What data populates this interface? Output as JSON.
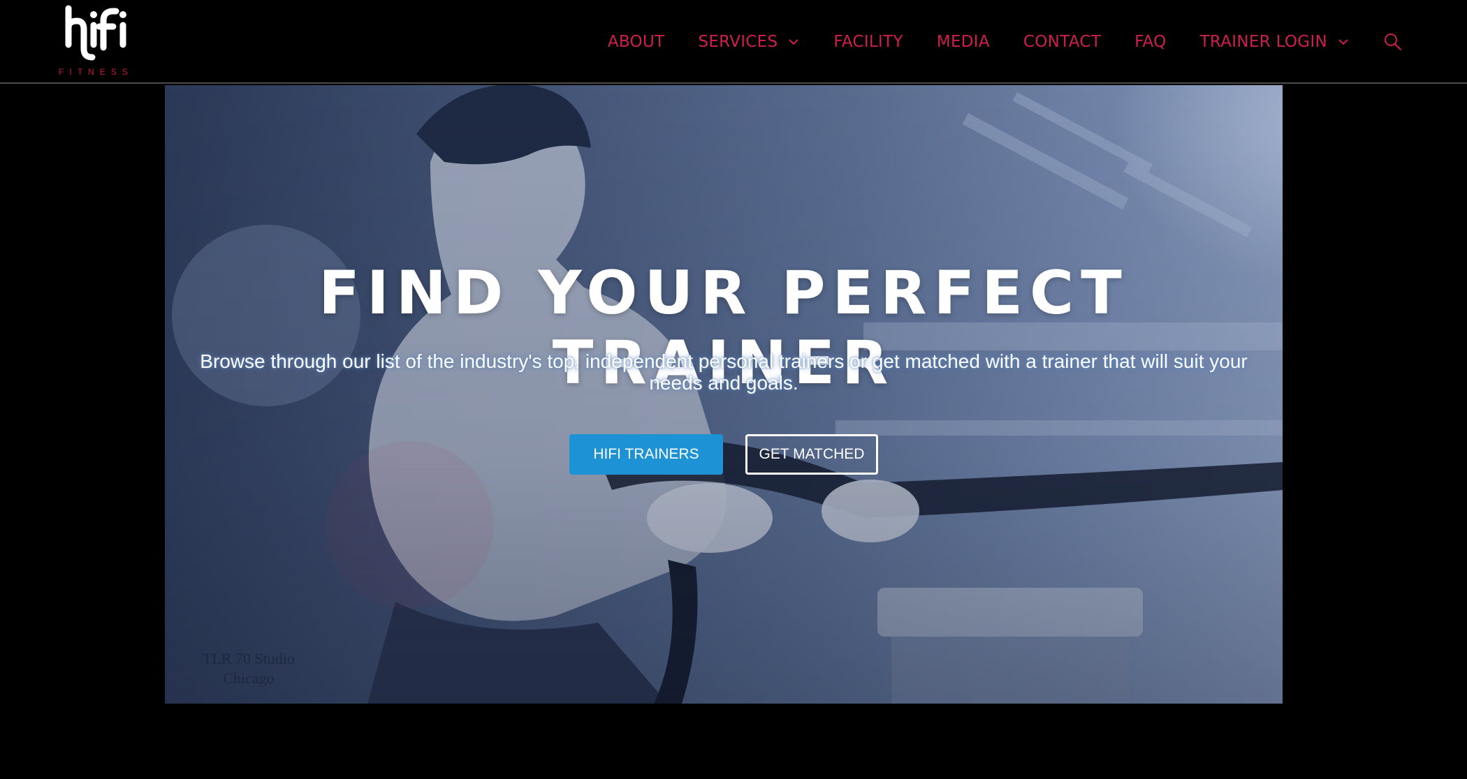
{
  "brand": {
    "logo_word": "hifi",
    "logo_sub": "FITNESS",
    "accent_color": "#d01f4c"
  },
  "nav": {
    "items": [
      {
        "label": "ABOUT",
        "has_dropdown": false
      },
      {
        "label": "SERVICES",
        "has_dropdown": true
      },
      {
        "label": "FACILITY",
        "has_dropdown": false
      },
      {
        "label": "MEDIA",
        "has_dropdown": false
      },
      {
        "label": "CONTACT",
        "has_dropdown": false
      },
      {
        "label": "FAQ",
        "has_dropdown": false
      },
      {
        "label": "TRAINER LOGIN",
        "has_dropdown": true
      }
    ],
    "search_icon": "search-icon"
  },
  "hero": {
    "title": "FIND YOUR PERFECT TRAINER",
    "subtitle": "Browse through our list of the industry's top, independent personal trainers or get matched with a trainer that will suit your needs and goals.",
    "primary_button": "HIFI TRAINERS",
    "secondary_button": "GET MATCHED",
    "primary_color": "#1d92d5",
    "watermark": "TLR 70 Studio Chicago"
  }
}
